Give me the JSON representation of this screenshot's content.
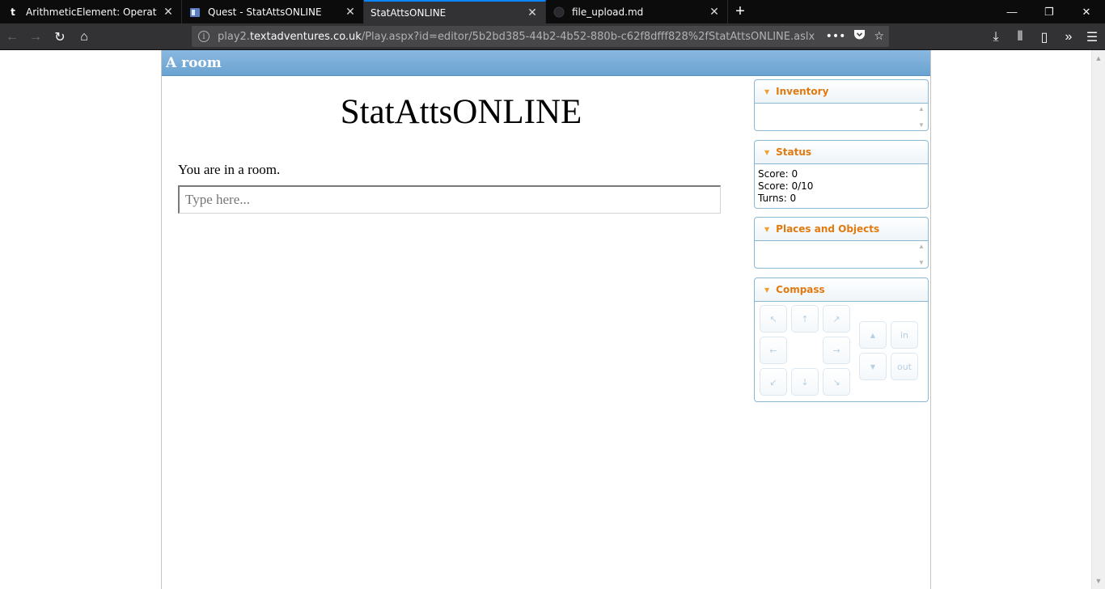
{
  "browser": {
    "tabs": [
      {
        "title": "ArithmeticElement: Operation",
        "favicon": "t",
        "active": false
      },
      {
        "title": "Quest - StatAttsONLINE",
        "favicon": "quest-icon",
        "active": false
      },
      {
        "title": "StatAttsONLINE",
        "favicon": "",
        "active": true
      },
      {
        "title": "file_upload.md",
        "favicon": "github-icon",
        "active": false
      }
    ],
    "url": {
      "prefix": "play2.",
      "host": "textadventures.co.uk",
      "path": "/Play.aspx?id=editor/5b2bd385-44b2-4b52-880b-c62f8dfff828%2fStatAttsONLINE.aslx"
    },
    "new_tab_glyph": "+"
  },
  "game": {
    "location": "A room",
    "title": "StatAttsONLINE",
    "room_description": "You are in a room.",
    "command_placeholder": "Type here..."
  },
  "panes": {
    "inventory": {
      "title": "Inventory"
    },
    "status": {
      "title": "Status",
      "lines": [
        "Score: 0",
        "Score: 0/10",
        "Turns: 0"
      ]
    },
    "places": {
      "title": "Places and Objects"
    },
    "compass": {
      "title": "Compass",
      "in_label": "in",
      "out_label": "out"
    }
  },
  "colors": {
    "tab_active_accent": "#0a84ff",
    "location_bar": "#6aa3d1",
    "pane_title": "#e07a10"
  }
}
